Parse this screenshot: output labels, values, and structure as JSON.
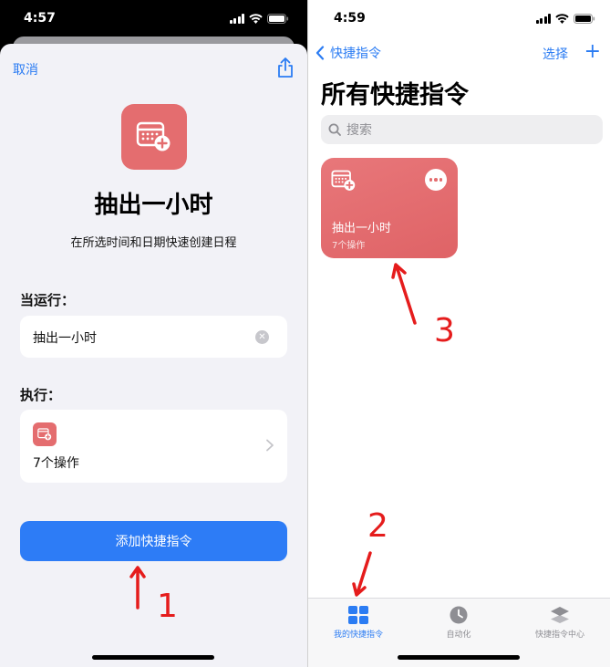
{
  "left_screen": {
    "status": {
      "time": "4:57"
    },
    "sheet": {
      "cancel_label": "取消",
      "share_icon": "share-icon",
      "shortcut_name": "抽出一小时",
      "description": "在所选时间和日期快速创建日程",
      "when_run_label": "当运行：",
      "when_run_value": "抽出一小时",
      "execute_label": "执行：",
      "actions_count": "7个操作",
      "add_button_label": "添加快捷指令",
      "tile_color": "#e46d6f",
      "accent_color": "#2d7cf6"
    },
    "annotation": "1"
  },
  "right_screen": {
    "status": {
      "time": "4:59"
    },
    "nav": {
      "back_label": "快捷指令",
      "select_label": "选择",
      "plus_label": "+"
    },
    "page_title": "所有快捷指令",
    "search": {
      "placeholder": "搜索"
    },
    "shortcut_card": {
      "title": "抽出一小时",
      "subtitle": "7个操作",
      "color": "#e46d6f"
    },
    "tabs": [
      {
        "label": "我的快捷指令",
        "icon": "grid-icon",
        "active": true
      },
      {
        "label": "自动化",
        "icon": "clock-icon",
        "active": false
      },
      {
        "label": "快捷指令中心",
        "icon": "layers-icon",
        "active": false
      }
    ],
    "annotations": [
      "2",
      "3"
    ]
  }
}
